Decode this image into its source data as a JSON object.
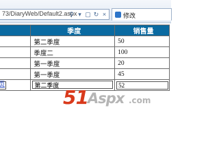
{
  "browser": {
    "address_url": "73/DiaryWeb/Default2.aspx",
    "tab_title": "修改"
  },
  "grid": {
    "headers": [
      "",
      "季度",
      "销售量"
    ],
    "rows": [
      {
        "quarter": "第二季度",
        "sales": "50"
      },
      {
        "quarter": "季度二",
        "sales": "100"
      },
      {
        "quarter": "第一季度",
        "sales": "20"
      },
      {
        "quarter": "第一季度",
        "sales": "45"
      }
    ],
    "edit_row": {
      "quarter_value": "第二季度",
      "sales_value": "52"
    }
  },
  "link_text": "页",
  "watermark": {
    "part1": "51",
    "part2": "Aspx",
    "part3": ".com"
  },
  "colors": {
    "header_bg": "#0a6aa1",
    "watermark_red": "#d93a1c",
    "watermark_gray": "#b5b5b5"
  }
}
